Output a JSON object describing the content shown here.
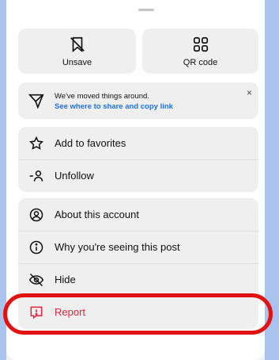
{
  "top_actions": {
    "unsave": "Unsave",
    "qr": "QR code"
  },
  "notice": {
    "line1": "We've moved things around.",
    "line2": "See where to share and copy link",
    "close": "×"
  },
  "menu_group_1": [
    {
      "label": "Add to favorites",
      "icon": "star-icon"
    },
    {
      "label": "Unfollow",
      "icon": "unfollow-icon"
    }
  ],
  "menu_group_2": [
    {
      "label": "About this account",
      "icon": "account-icon"
    },
    {
      "label": "Why you're seeing this post",
      "icon": "info-icon"
    },
    {
      "label": "Hide",
      "icon": "hide-icon"
    },
    {
      "label": "Report",
      "icon": "report-icon"
    }
  ],
  "colors": {
    "report": "#e0243b",
    "link": "#1a73e8",
    "highlight": "#e01212"
  }
}
